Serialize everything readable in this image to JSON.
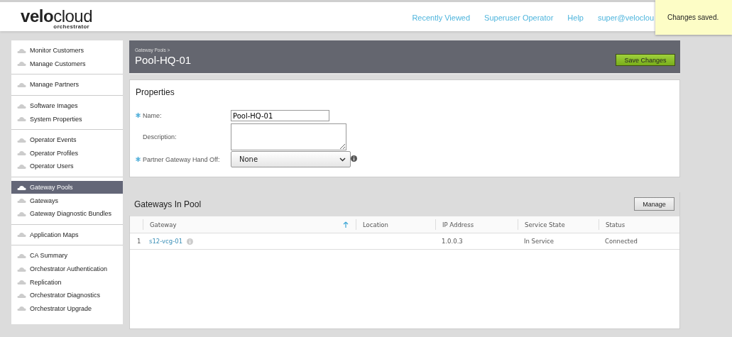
{
  "header": {
    "logo": {
      "bold": "velo",
      "light": "cloud",
      "subtitle": "orchestrator"
    },
    "links": [
      {
        "label": "Recently Viewed"
      },
      {
        "label": "Superuser Operator"
      },
      {
        "label": "Help"
      },
      {
        "label": "super@veloclou"
      }
    ],
    "toast": "Changes saved."
  },
  "sidebar": {
    "groups": [
      [
        {
          "label": "Monitor Customers",
          "selected": false
        },
        {
          "label": "Manage Customers",
          "selected": false
        }
      ],
      [
        {
          "label": "Manage Partners",
          "selected": false
        }
      ],
      [
        {
          "label": "Software Images",
          "selected": false
        },
        {
          "label": "System Properties",
          "selected": false
        }
      ],
      [
        {
          "label": "Operator Events",
          "selected": false
        },
        {
          "label": "Operator Profiles",
          "selected": false
        },
        {
          "label": "Operator Users",
          "selected": false
        }
      ],
      [
        {
          "label": "Gateway Pools",
          "selected": true
        },
        {
          "label": "Gateways",
          "selected": false
        },
        {
          "label": "Gateway Diagnostic Bundles",
          "selected": false
        }
      ],
      [
        {
          "label": "Application Maps",
          "selected": false
        }
      ],
      [
        {
          "label": "CA Summary",
          "selected": false
        },
        {
          "label": "Orchestrator Authentication",
          "selected": false
        },
        {
          "label": "Replication",
          "selected": false
        },
        {
          "label": "Orchestrator Diagnostics",
          "selected": false
        },
        {
          "label": "Orchestrator Upgrade",
          "selected": false
        }
      ]
    ]
  },
  "page": {
    "breadcrumb": "Gateway Pools >",
    "title": "Pool-HQ-01",
    "save_button": "Save Changes"
  },
  "properties": {
    "title": "Properties",
    "fields": [
      {
        "kind": "text",
        "label": "Name:",
        "required": true,
        "value": "Pool-HQ-01"
      },
      {
        "kind": "textarea",
        "label": "Description:",
        "required": false
      },
      {
        "kind": "select",
        "label": "Partner Gateway Hand Off:",
        "required": true,
        "value": "None",
        "info": true
      }
    ]
  },
  "gateways": {
    "title": "Gateways In Pool",
    "manage_button": "Manage",
    "columns": [
      {
        "label": "Gateway",
        "sorted": true
      },
      {
        "label": "Location",
        "sorted": false
      },
      {
        "label": "IP Address",
        "sorted": false
      },
      {
        "label": "Service State",
        "sorted": false
      },
      {
        "label": "Status",
        "sorted": false
      }
    ],
    "rows": [
      {
        "number": "1",
        "gateway": "s12-vcg-01",
        "ip_address": "1.0.0.3",
        "service_state": "In Service",
        "status": "Connected"
      }
    ]
  }
}
